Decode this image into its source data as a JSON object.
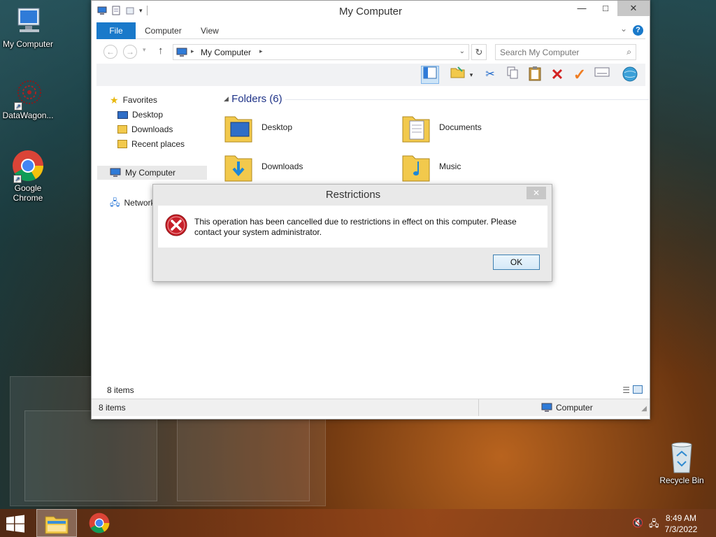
{
  "desktop": {
    "icons": [
      {
        "label": "My Computer"
      },
      {
        "label": "DataWagon..."
      },
      {
        "label": "Google Chrome"
      },
      {
        "label": "Recycle Bin"
      }
    ]
  },
  "window": {
    "title": "My Computer",
    "controls": {
      "minimize": "—",
      "maximize": "□",
      "close": "✕"
    },
    "ribbon_tabs": {
      "file": "File",
      "computer": "Computer",
      "view": "View",
      "help": "?"
    },
    "address": {
      "path": "My Computer"
    },
    "search": {
      "placeholder": "Search My Computer"
    },
    "nav": {
      "favorites": "Favorites",
      "desktop": "Desktop",
      "downloads": "Downloads",
      "recent": "Recent places",
      "my_computer": "My Computer",
      "network": "Network"
    },
    "folders_header": "Folders (6)",
    "folders": [
      {
        "name": "Desktop"
      },
      {
        "name": "Documents"
      },
      {
        "name": "Downloads"
      },
      {
        "name": "Music"
      }
    ],
    "item_count": "8 items",
    "status_count": "8 items",
    "status_location": "Computer"
  },
  "dialog": {
    "title": "Restrictions",
    "close": "✕",
    "message": "This operation has been cancelled due to restrictions in effect on this computer. Please contact your system administrator.",
    "ok": "OK"
  },
  "taskbar": {
    "time": "8:49 AM",
    "date": "7/3/2022"
  },
  "colors": {
    "ribbon_accent": "#1979ca",
    "folder_header": "#1e3287",
    "error_red": "#c8202a"
  }
}
